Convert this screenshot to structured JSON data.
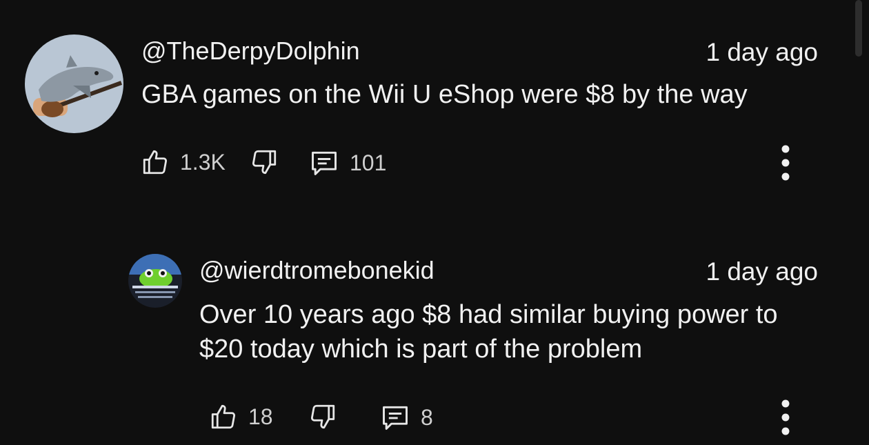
{
  "comments": [
    {
      "author": "@TheDerpyDolphin",
      "timestamp": "1 day ago",
      "text": "GBA games on the Wii U eShop were $8 by the way",
      "likes": "1.3K",
      "replies": "101",
      "avatar_icon": "dolphin-guitar-avatar",
      "like_icon": "thumb-up-icon",
      "dislike_icon": "thumb-down-icon",
      "reply_icon": "comment-icon",
      "menu_icon": "more-vert-icon"
    },
    {
      "author": "@wierdtromebonekid",
      "timestamp": "1 day ago",
      "text": "Over 10 years ago $8 had similar buying power to $20 today which is part of the problem",
      "likes": "18",
      "replies": "8",
      "avatar_icon": "frog-avatar",
      "like_icon": "thumb-up-icon",
      "dislike_icon": "thumb-down-icon",
      "reply_icon": "comment-icon",
      "menu_icon": "more-vert-icon"
    }
  ],
  "colors": {
    "background": "#0f0f0f",
    "text": "#f1f1f1",
    "secondary": "#cfcfcf"
  }
}
